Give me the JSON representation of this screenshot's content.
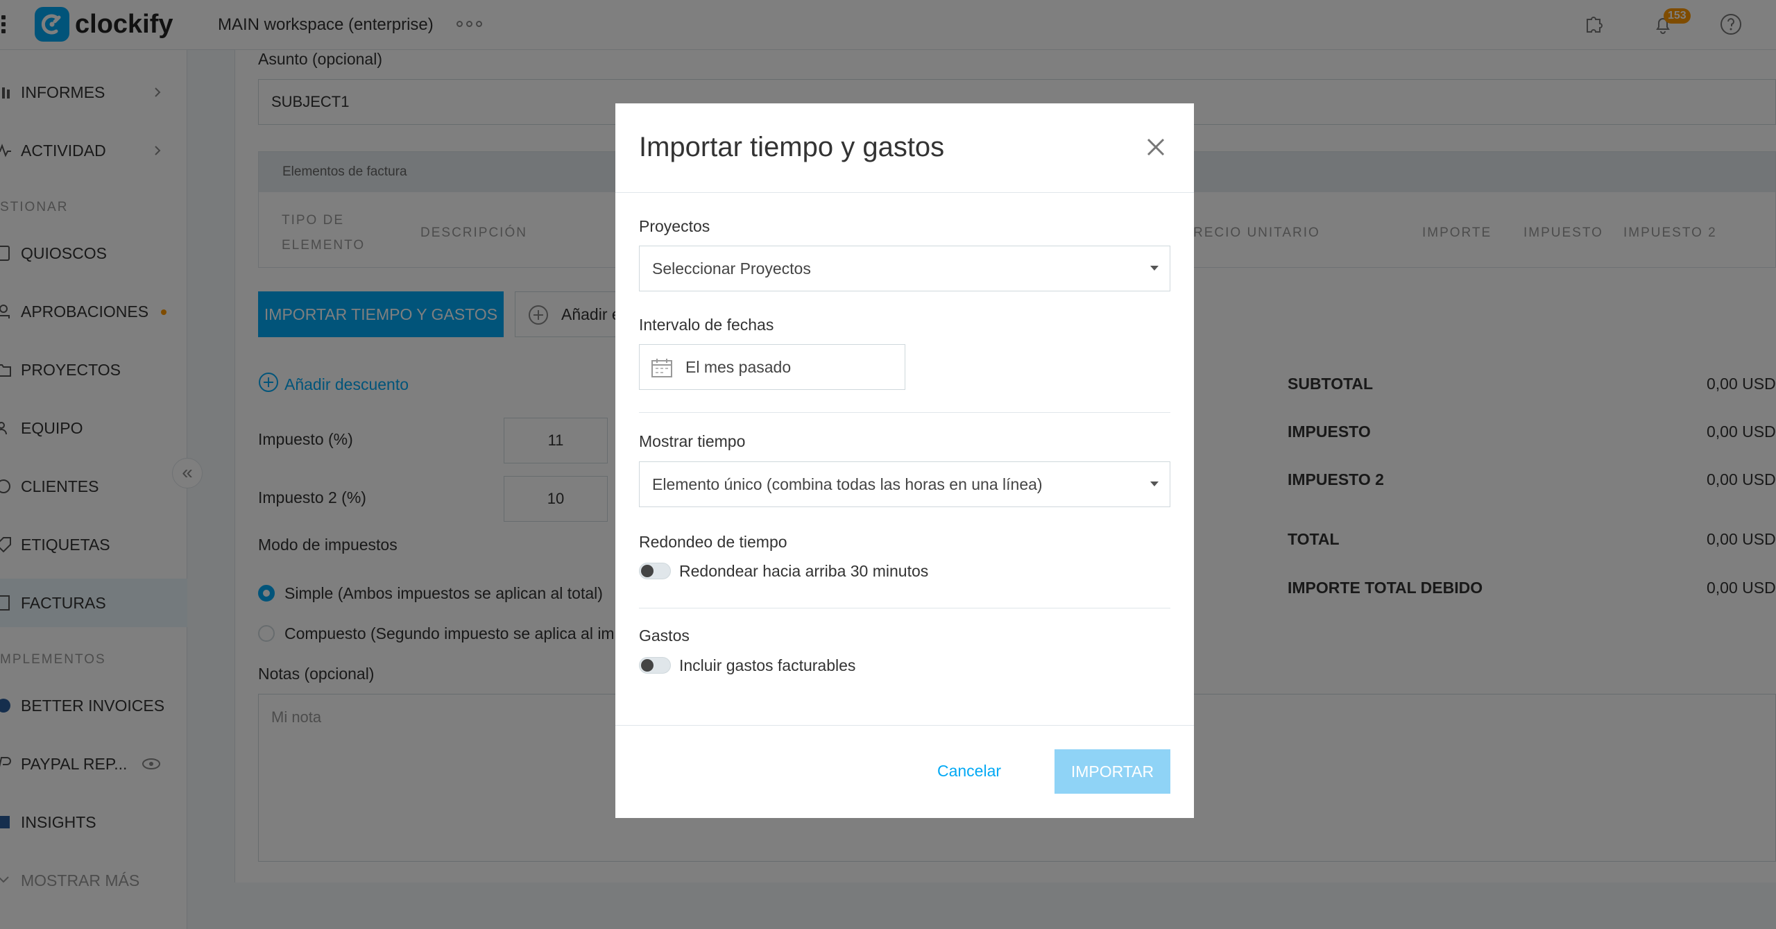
{
  "header": {
    "brand": "clockify",
    "workspace": "MAIN workspace (enterprise)",
    "notification_count": "153"
  },
  "sidebar": {
    "items": [
      {
        "label": "INFORMES",
        "icon": "bar-chart-icon"
      },
      {
        "label": "ACTIVIDAD",
        "icon": "activity-icon"
      },
      {
        "label": "QUIOSCOS",
        "icon": "kiosk-icon"
      },
      {
        "label": "APROBACIONES",
        "icon": "approval-icon"
      },
      {
        "label": "PROYECTOS",
        "icon": "folder-icon"
      },
      {
        "label": "EQUIPO",
        "icon": "team-icon"
      },
      {
        "label": "CLIENTES",
        "icon": "client-icon"
      },
      {
        "label": "ETIQUETAS",
        "icon": "tag-icon"
      },
      {
        "label": "FACTURAS",
        "icon": "invoice-icon"
      },
      {
        "label": "BETTER INVOICES",
        "icon": "addon-icon"
      },
      {
        "label": "PAYPAL REP...",
        "icon": "paypal-icon"
      },
      {
        "label": "INSIGHTS",
        "icon": "insights-icon"
      },
      {
        "label": "MOSTRAR MÁS",
        "icon": "more-icon"
      }
    ],
    "sections": [
      "STIONAR",
      "MPLEMENTOS"
    ]
  },
  "invoice": {
    "subject_label": "Asunto (opcional)",
    "subject_value": "SUBJECT1",
    "items_title": "Elementos de factura",
    "columns": [
      "TIPO DE ELEMENTO",
      "DESCRIPCIÓN",
      "RECIO UNITARIO",
      "IMPORTE",
      "IMPUESTO",
      "IMPUESTO 2"
    ],
    "import_button": "IMPORTAR TIEMPO Y GASTOS",
    "add_item_button": "Añadir e",
    "add_discount": "Añadir descuento",
    "tax_label": "Impuesto (%)",
    "tax_value": "11",
    "tax2_label": "Impuesto 2 (%)",
    "tax2_value": "10",
    "tax_mode_label": "Modo de impuestos",
    "tax_mode_simple": "Simple (Ambos impuestos se aplican al total)",
    "tax_mode_compound": "Compuesto (Segundo impuesto se aplica al im",
    "notes_label": "Notas (opcional)",
    "notes_placeholder": "Mi nota",
    "summary": [
      {
        "label": "SUBTOTAL",
        "value": "0,00 USD"
      },
      {
        "label": "IMPUESTO",
        "value": "0,00 USD"
      },
      {
        "label": "IMPUESTO 2",
        "value": "0,00 USD"
      },
      {
        "label": "TOTAL",
        "value": "0,00 USD"
      },
      {
        "label": "IMPORTE TOTAL DEBIDO",
        "value": "0,00 USD"
      }
    ]
  },
  "modal": {
    "title": "Importar tiempo y gastos",
    "projects_label": "Proyectos",
    "projects_placeholder": "Seleccionar Proyectos",
    "date_range_label": "Intervalo de fechas",
    "date_range_value": "El mes pasado",
    "show_time_label": "Mostrar tiempo",
    "show_time_value": "Elemento único (combina todas las horas en una línea)",
    "rounding_label": "Redondeo de tiempo",
    "rounding_toggle": "Redondear hacia arriba 30 minutos",
    "expenses_label": "Gastos",
    "expenses_toggle": "Incluir gastos facturables",
    "cancel": "Cancelar",
    "import": "IMPORTAR"
  },
  "colors": {
    "accent": "#03a9f4",
    "accent_disabled": "#8fd3f6",
    "badge": "#ff9800"
  }
}
